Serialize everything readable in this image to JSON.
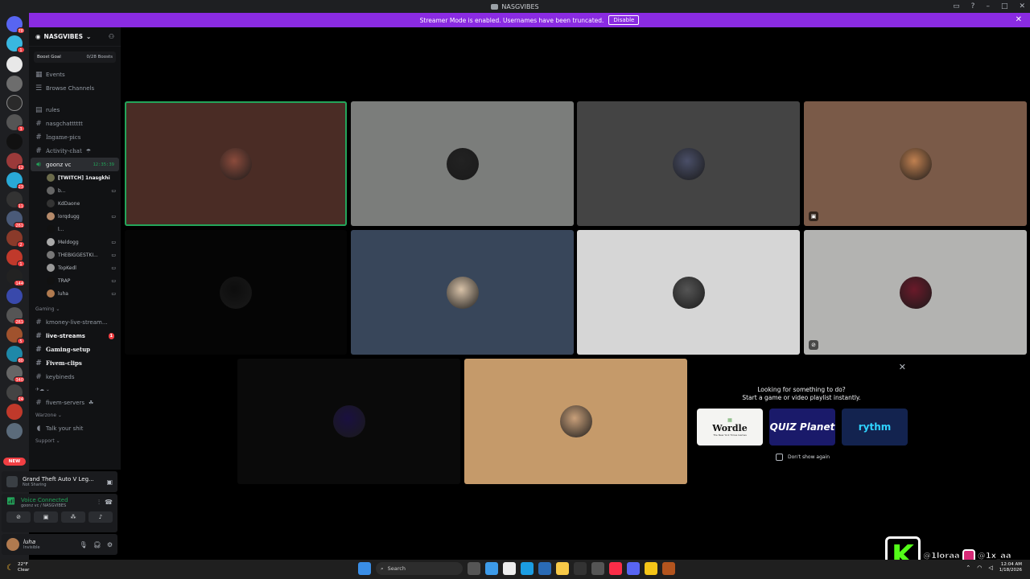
{
  "window": {
    "title": "NASGVIBES"
  },
  "banner": {
    "text": "Streamer Mode is enabled. Usernames have been truncated.",
    "button": "Disable"
  },
  "rail": {
    "badges": [
      "78",
      "1",
      "3",
      "12",
      "11",
      "23",
      "261",
      "2",
      "1",
      "144",
      "261",
      "5",
      "80",
      "340",
      "24"
    ],
    "new_label": "NEW"
  },
  "server": {
    "name": "NASGVIBES",
    "boost_goal_label": "Boost Goal",
    "boost_value": "0/28 Boosts"
  },
  "nav": {
    "events": "Events",
    "browse": "Browse Channels"
  },
  "channels_top": [
    {
      "name": "rules",
      "kind": "rules"
    },
    {
      "name": "nasgchatttttt",
      "kind": "text"
    },
    {
      "name": "Ingame-pics",
      "kind": "text-serif"
    },
    {
      "name": "Activity-chat",
      "kind": "text-serif"
    }
  ],
  "voice_channel": {
    "name": "goonz vc",
    "timer": "12:35:39"
  },
  "voice_users": [
    {
      "name": "[TWITCH] 1nasgkhi",
      "color": "#6b6b4b",
      "bold": true
    },
    {
      "name": "b...",
      "color": "#666",
      "bold": false
    },
    {
      "name": "KdDaone",
      "color": "#333",
      "bold": false
    },
    {
      "name": "lorqdugg",
      "color": "#b58a6a",
      "bold": false
    },
    {
      "name": "l...",
      "color": "#111",
      "bold": false
    },
    {
      "name": "Meldogg",
      "color": "#aaa",
      "bold": false
    },
    {
      "name": "THEBIGGESTKI...",
      "color": "#777",
      "bold": false
    },
    {
      "name": "TopKedl",
      "color": "#999",
      "bold": false
    },
    {
      "name": "TRAP",
      "color": "#111",
      "bold": false
    },
    {
      "name": "luha",
      "color": "#b07a4f",
      "bold": false
    }
  ],
  "categories": {
    "gaming": "Gaming",
    "warzone": "Warzone",
    "support": "Support"
  },
  "gaming_channels": [
    {
      "name": "kmoney-live-stream...",
      "bright": false,
      "serif": false,
      "unread": ""
    },
    {
      "name": "live-streams",
      "bright": true,
      "serif": false,
      "unread": "1"
    },
    {
      "name": "Gaming-setup",
      "bright": true,
      "serif": true,
      "unread": ""
    },
    {
      "name": "Fivem-clips",
      "bright": true,
      "serif": true,
      "unread": ""
    },
    {
      "name": "keybineds",
      "bright": false,
      "serif": false,
      "unread": ""
    }
  ],
  "misc_channel": "fivem-servers",
  "warzone_channel": "Talk your shit",
  "activity": {
    "title": "Grand Theft Auto V Leg...",
    "status": "Not Sharing"
  },
  "voice_status": {
    "title": "Voice Connected",
    "subtitle": "goonz vc / NASGVIBES"
  },
  "user": {
    "name": "luha",
    "status": "Invisible"
  },
  "tiles": [
    {
      "bg": "#4a2c25",
      "avatar": "#8b4b3c",
      "speaking": true,
      "icon": ""
    },
    {
      "bg": "#7b7d7b",
      "avatar": "#222",
      "speaking": false,
      "icon": ""
    },
    {
      "bg": "#444444",
      "avatar": "#4a4f68",
      "speaking": false,
      "icon": ""
    },
    {
      "bg": "#7a5a48",
      "avatar": "#c08050",
      "speaking": false,
      "icon": "screen"
    },
    {
      "bg": "#050505",
      "avatar": "#0d0d0d",
      "speaking": false,
      "icon": ""
    },
    {
      "bg": "#38465a",
      "avatar": "#d8c2a8",
      "speaking": false,
      "icon": ""
    },
    {
      "bg": "#d6d6d6",
      "avatar": "#555",
      "speaking": false,
      "icon": ""
    },
    {
      "bg": "#b3b3b1",
      "avatar": "#6a1a2a",
      "speaking": false,
      "icon": "mute"
    },
    {
      "bg": "#0a0a0a",
      "avatar": "#1a1040",
      "speaking": false,
      "icon": ""
    },
    {
      "bg": "#c59a6a",
      "avatar": "#c9a07a",
      "speaking": false,
      "icon": ""
    }
  ],
  "promo": {
    "line1": "Looking for something to do?",
    "line2": "Start a game or video playlist instantly.",
    "cards": [
      "Wordle",
      "QUIZ Planet",
      "rythm"
    ],
    "wordle_sub": "The New York Times Games",
    "dont_show": "Don't show again"
  },
  "watermark": {
    "k": "K",
    "kick": "@1loraa",
    "insta": "@1x_aa"
  },
  "taskbar": {
    "temp": "22°F",
    "cond": "Clear",
    "search": "Search",
    "time": "12:04 AM",
    "date": "1/18/2026"
  }
}
